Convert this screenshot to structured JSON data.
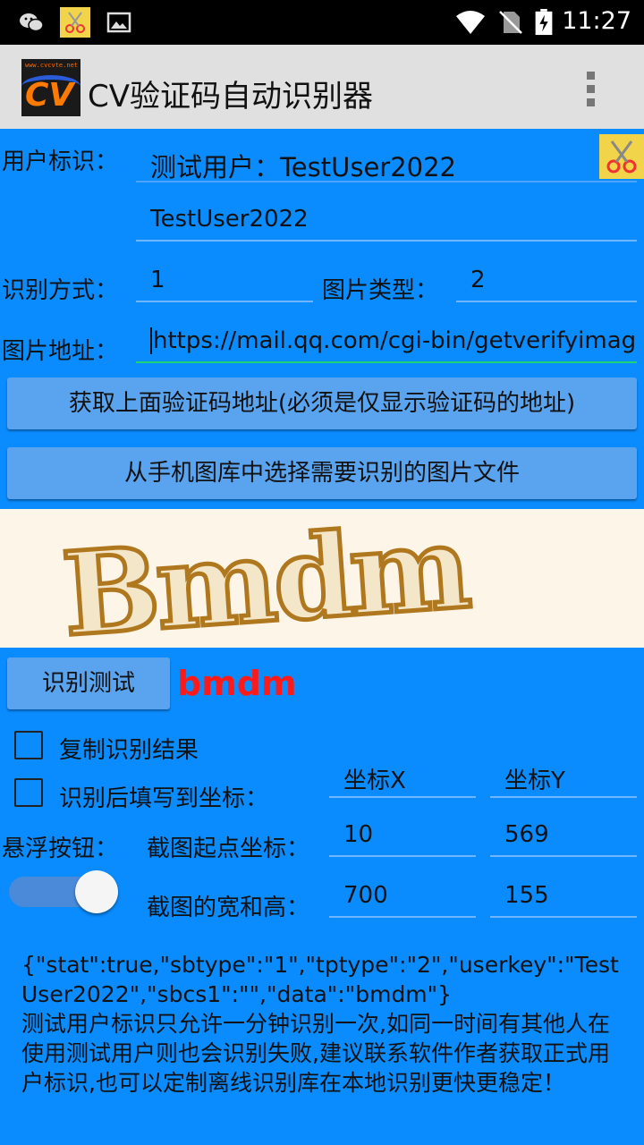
{
  "status_bar": {
    "time": "11:27"
  },
  "app": {
    "title": "CV验证码自动识别器",
    "logo_text": "CV",
    "logo_site": "www.cvcvte.net"
  },
  "form": {
    "user_label": "用户标识：",
    "user_select_value": "测试用户：TestUser2022",
    "user_input_value": "TestUser2022",
    "method_label": "识别方式：",
    "method_value": "1",
    "imgtype_label": "图片类型：",
    "imgtype_value": "2",
    "url_label": "图片地址：",
    "url_value": "https://mail.qq.com/cgi-bin/getverifyimage",
    "fetch_button": "获取上面验证码地址(必须是仅显示验证码的地址)",
    "gallery_button": "从手机图库中选择需要识别的图片文件"
  },
  "captcha": {
    "text": "Bmdm"
  },
  "recognize": {
    "button": "识别测试",
    "result": "bmdm",
    "copy_label": "复制识别结果",
    "fill_label": "识别后填写到坐标：",
    "coord_x_placeholder": "坐标X",
    "coord_y_placeholder": "坐标Y",
    "float_label": "悬浮按钮：",
    "start_label": "截图起点坐标：",
    "start_x": "10",
    "start_y": "569",
    "size_label": "截图的宽和高：",
    "width": "700",
    "height": "155",
    "float_toggle_on": true
  },
  "output": {
    "json_line": "{\"stat\":true,\"sbtype\":\"1\",\"tptype\":\"2\",\"userkey\":\"TestUser2022\",\"sbcs1\":\"\",\"data\":\"bmdm\"}",
    "notice": "测试用户标识只允许一分钟识别一次,如同一时间有其他人在使用测试用户则也会识别失败,建议联系软件作者获取正式用户标识,也可以定制离线识别库在本地识别更快更稳定！"
  },
  "colors": {
    "background": "#0a8cff",
    "result_red": "#ff1a1a",
    "button": "#5aa3ee"
  }
}
